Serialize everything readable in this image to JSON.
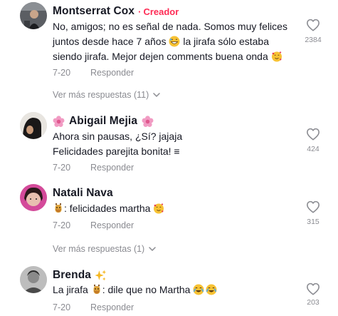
{
  "comments": [
    {
      "name": "Montserrat Cox",
      "badge": "Creador",
      "badge_separator": "·",
      "text_line1": "No, amigos; no es señal de nada. Somos muy felices",
      "text_line2a": "juntos desde hace 7 años",
      "text_line2b": "la jirafa sólo estaba",
      "text_line3": "siendo jirafa. Mejor dejen comments buena onda",
      "date": "7-20",
      "reply": "Responder",
      "likes": "2384",
      "more_replies": "Ver más respuestas (11)"
    },
    {
      "name": "Abigail Mejia",
      "text_line1": "Ahora sin pausas, ¿Sí? jajaja",
      "text_line2": "Felicidades parejita bonita! ≡",
      "date": "7-20",
      "reply": "Responder",
      "likes": "424"
    },
    {
      "name": "Natali Nava",
      "text_line1": ": felicidades martha",
      "date": "7-20",
      "reply": "Responder",
      "likes": "315",
      "more_replies": "Ver más respuestas (1)"
    },
    {
      "name": "Brenda",
      "text_line1a": "La jirafa",
      "text_line1b": ": dile que no Martha",
      "date": "7-20",
      "reply": "Responder",
      "likes": "203"
    }
  ],
  "colors": {
    "creator_badge": "#fe2c55",
    "muted": "#8a8b91",
    "text": "#161823"
  },
  "icons": [
    "heart-outline-icon",
    "chevron-down-icon",
    "giraffe-emoji",
    "grin-emoji",
    "smiling-hearts-emoji",
    "joy-emoji",
    "flower-emoji",
    "sparkles-emoji"
  ]
}
